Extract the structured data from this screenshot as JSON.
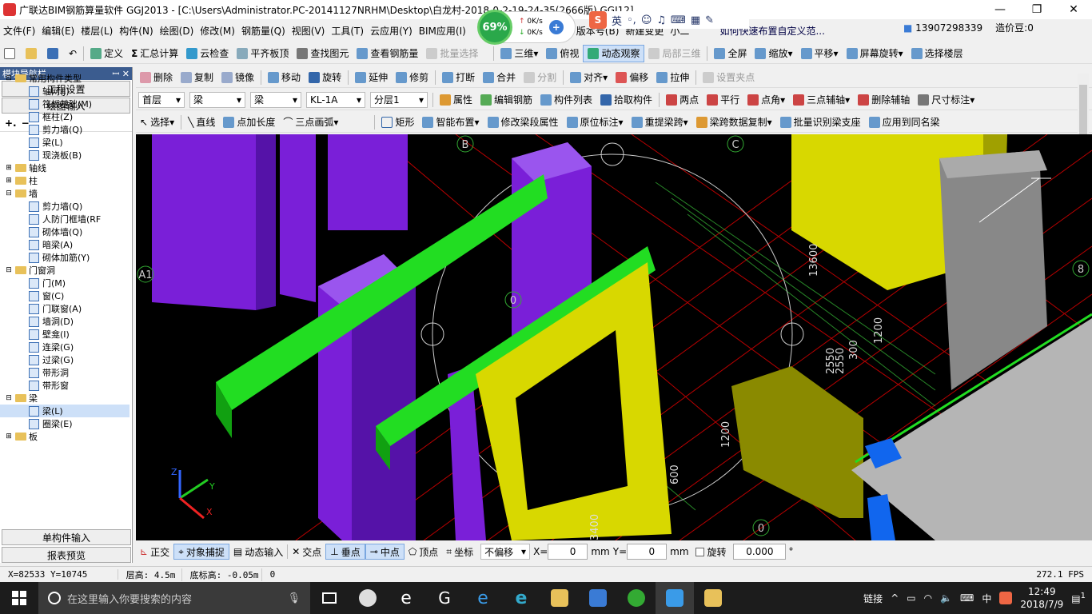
{
  "window": {
    "title": "广联达BIM钢筋算量软件 GGJ2013 - [C:\\Users\\Administrator.PC-20141127NRHM\\Desktop\\白龙村-2018-0-2-19-24-35(2666版).GGJ12]",
    "controls": [
      "—",
      "❐",
      "✕"
    ]
  },
  "netwidget": {
    "percent": "69%",
    "up": "0K/s",
    "down": "0K/s"
  },
  "ime": {
    "mode": "英",
    "brand": "S"
  },
  "menu": [
    "文件(F)",
    "编辑(E)",
    "楼层(L)",
    "构件(N)",
    "绘图(D)",
    "修改(M)",
    "钢筋量(Q)",
    "视图(V)",
    "工具(T)",
    "云应用(Y)",
    "BIM应用(I)",
    "版本号(B)",
    "新建变更",
    "小二",
    "如何快速布置自定义范..."
  ],
  "user": {
    "phone": "13907298339",
    "bean": "造价豆:0"
  },
  "toolbar1": [
    "定义",
    "汇总计算",
    "云检查",
    "平齐板顶",
    "查找图元",
    "查看钢筋量",
    "批量选择",
    "三维",
    "俯视",
    "动态观察",
    "局部三维",
    "全屏",
    "缩放",
    "平移",
    "屏幕旋转",
    "选择楼层"
  ],
  "toolbar2": [
    "删除",
    "复制",
    "镜像",
    "移动",
    "旋转",
    "延伸",
    "修剪",
    "打断",
    "合并",
    "分割",
    "对齐",
    "偏移",
    "拉伸",
    "设置夹点"
  ],
  "toolbar3": {
    "floor": "首层",
    "type1": "梁",
    "type2": "梁",
    "member": "KL-1A",
    "layer": "分层1",
    "buttons": [
      "属性",
      "编辑钢筋",
      "构件列表",
      "拾取构件",
      "两点",
      "平行",
      "点角",
      "三点辅轴",
      "删除辅轴",
      "尺寸标注"
    ]
  },
  "toolbar4": [
    "选择",
    "直线",
    "点加长度",
    "三点画弧",
    "矩形",
    "智能布置",
    "修改梁段属性",
    "原位标注",
    "重提梁跨",
    "梁跨数据复制",
    "批量识别梁支座",
    "应用到同名梁"
  ],
  "sidebar": {
    "header": "模块导航栏",
    "pin": "ꟷ ✕",
    "tab_project": "工程设置",
    "tab_draw": "绘图输入",
    "tree": [
      {
        "level": 0,
        "exp": "⊟",
        "folder": true,
        "label": "常用构件类型"
      },
      {
        "level": 1,
        "label": "轴网(J)"
      },
      {
        "level": 1,
        "label": "筏板基础(M)"
      },
      {
        "level": 1,
        "label": "框柱(Z)"
      },
      {
        "level": 1,
        "label": "剪力墙(Q)"
      },
      {
        "level": 1,
        "label": "梁(L)"
      },
      {
        "level": 1,
        "label": "现浇板(B)"
      },
      {
        "level": 0,
        "exp": "⊞",
        "folder": true,
        "label": "轴线"
      },
      {
        "level": 0,
        "exp": "⊞",
        "folder": true,
        "label": "柱"
      },
      {
        "level": 0,
        "exp": "⊟",
        "folder": true,
        "label": "墙"
      },
      {
        "level": 1,
        "label": "剪力墙(Q)"
      },
      {
        "level": 1,
        "label": "人防门框墙(RF"
      },
      {
        "level": 1,
        "label": "砌体墙(Q)"
      },
      {
        "level": 1,
        "label": "暗梁(A)"
      },
      {
        "level": 1,
        "label": "砌体加筋(Y)"
      },
      {
        "level": 0,
        "exp": "⊟",
        "folder": true,
        "label": "门窗洞"
      },
      {
        "level": 1,
        "label": "门(M)"
      },
      {
        "level": 1,
        "label": "窗(C)"
      },
      {
        "level": 1,
        "label": "门联窗(A)"
      },
      {
        "level": 1,
        "label": "墙洞(D)"
      },
      {
        "level": 1,
        "label": "壁龛(I)"
      },
      {
        "level": 1,
        "label": "连梁(G)"
      },
      {
        "level": 1,
        "label": "过梁(G)"
      },
      {
        "level": 1,
        "label": "带形洞"
      },
      {
        "level": 1,
        "label": "带形窗"
      },
      {
        "level": 0,
        "exp": "⊟",
        "folder": true,
        "label": "梁"
      },
      {
        "level": 1,
        "label": "梁(L)",
        "selected": true
      },
      {
        "level": 1,
        "label": "圈梁(E)"
      },
      {
        "level": 0,
        "exp": "⊞",
        "folder": true,
        "label": "板"
      }
    ],
    "tab_single": "单构件输入",
    "tab_report": "报表预览"
  },
  "viewport": {
    "axis_labels": [
      "B",
      "C",
      "A1",
      "0",
      "8",
      "0"
    ],
    "dims": [
      "13600",
      "1200",
      "300",
      "2550",
      "2550",
      "1200",
      "600",
      "3400"
    ],
    "axes": {
      "x": "X",
      "y": "Y",
      "z": "Z"
    }
  },
  "snapbar": {
    "buttons": [
      "正交",
      "对象捕捉",
      "动态输入",
      "交点",
      "垂点",
      "中点",
      "顶点",
      "坐标"
    ],
    "offset": "不偏移",
    "x_label": "X=",
    "x_val": "0",
    "unit1": "mm",
    "y_label": "Y=",
    "y_val": "0",
    "unit2": "mm",
    "rotate_label": "旋转",
    "rotate_val": "0.000",
    "deg": "°"
  },
  "status": {
    "coords": "X=82533 Y=10745",
    "floor_h": "层高: 4.5m",
    "base_h": "底标高: -0.05m",
    "zero": "0",
    "fps": "272.1 FPS"
  },
  "taskbar": {
    "search": "在这里输入你要搜索的内容",
    "tray_label": "链接",
    "lang": "中",
    "time": "12:49",
    "date": "2018/7/9",
    "notif": "1"
  }
}
